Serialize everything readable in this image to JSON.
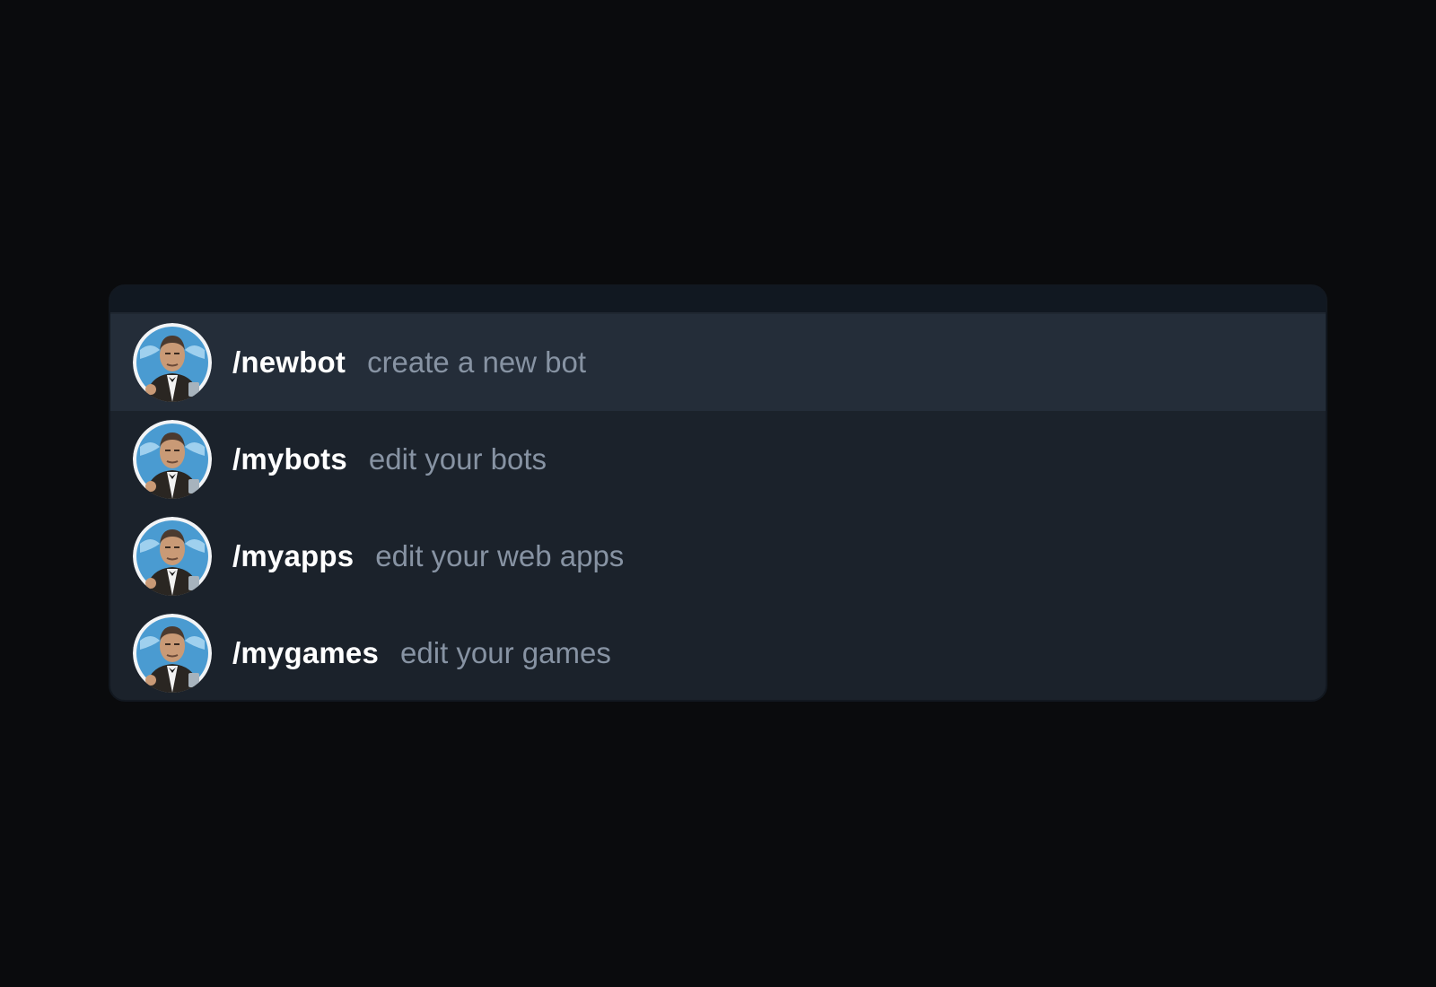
{
  "commands": [
    {
      "command": "/newbot",
      "description": "create a new bot",
      "selected": true
    },
    {
      "command": "/mybots",
      "description": "edit your bots",
      "selected": false
    },
    {
      "command": "/myapps",
      "description": "edit your web apps",
      "selected": false
    },
    {
      "command": "/mygames",
      "description": "edit your games",
      "selected": false
    }
  ],
  "icons": {
    "avatar": "botfather-avatar-icon"
  },
  "colors": {
    "background": "#0a0b0d",
    "panel": "#1b222b",
    "selected_row": "#242d39",
    "command_text": "#ffffff",
    "description_text": "#8793a3"
  }
}
